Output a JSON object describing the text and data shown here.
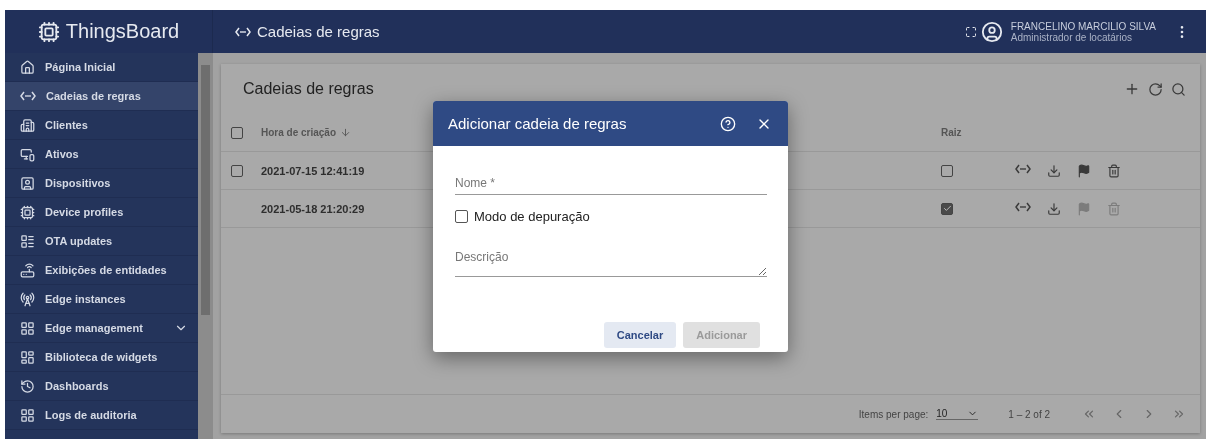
{
  "app": {
    "logo": "ThingsBoard",
    "page_title": "Cadeias de regras",
    "user": {
      "name": "FRANCELINO MARCILIO SILVA",
      "role": "Administrador de locatários"
    }
  },
  "sidebar": {
    "items": [
      {
        "label": "Página Inicial",
        "selected": false,
        "expandable": false
      },
      {
        "label": "Cadeias de regras",
        "selected": true,
        "expandable": false
      },
      {
        "label": "Clientes",
        "selected": false,
        "expandable": false
      },
      {
        "label": "Ativos",
        "selected": false,
        "expandable": false
      },
      {
        "label": "Dispositivos",
        "selected": false,
        "expandable": false
      },
      {
        "label": "Device profiles",
        "selected": false,
        "expandable": false
      },
      {
        "label": "OTA updates",
        "selected": false,
        "expandable": false
      },
      {
        "label": "Exibições de entidades",
        "selected": false,
        "expandable": false
      },
      {
        "label": "Edge instances",
        "selected": false,
        "expandable": false
      },
      {
        "label": "Edge management",
        "selected": false,
        "expandable": true
      },
      {
        "label": "Biblioteca de widgets",
        "selected": false,
        "expandable": false
      },
      {
        "label": "Dashboards",
        "selected": false,
        "expandable": false
      },
      {
        "label": "Logs de auditoria",
        "selected": false,
        "expandable": false
      }
    ]
  },
  "card": {
    "title": "Cadeias de regras",
    "table": {
      "select_all": {
        "checked": false
      },
      "columns": [
        {
          "label": "Hora de criação",
          "sorted": true
        },
        {
          "label": "Raiz",
          "sorted": false
        }
      ],
      "rows": [
        {
          "selectable": true,
          "checked": false,
          "created": "2021-07-15 12:41:19",
          "root": false
        },
        {
          "selectable": false,
          "created": "2021-05-18 21:20:29",
          "root": true
        }
      ]
    },
    "paginator": {
      "label": "Items per page:",
      "page_size": "10",
      "range": "1 – 2 of 2"
    }
  },
  "dialog": {
    "title": "Adicionar cadeia de regras",
    "name_field": {
      "placeholder": "Nome *"
    },
    "debug": {
      "label": "Modo de depuração",
      "checked": false
    },
    "description_field": {
      "placeholder": "Descrição"
    },
    "buttons": [
      {
        "label": "Cancelar",
        "disabled": false
      },
      {
        "label": "Adicionar",
        "disabled": true
      }
    ]
  }
}
